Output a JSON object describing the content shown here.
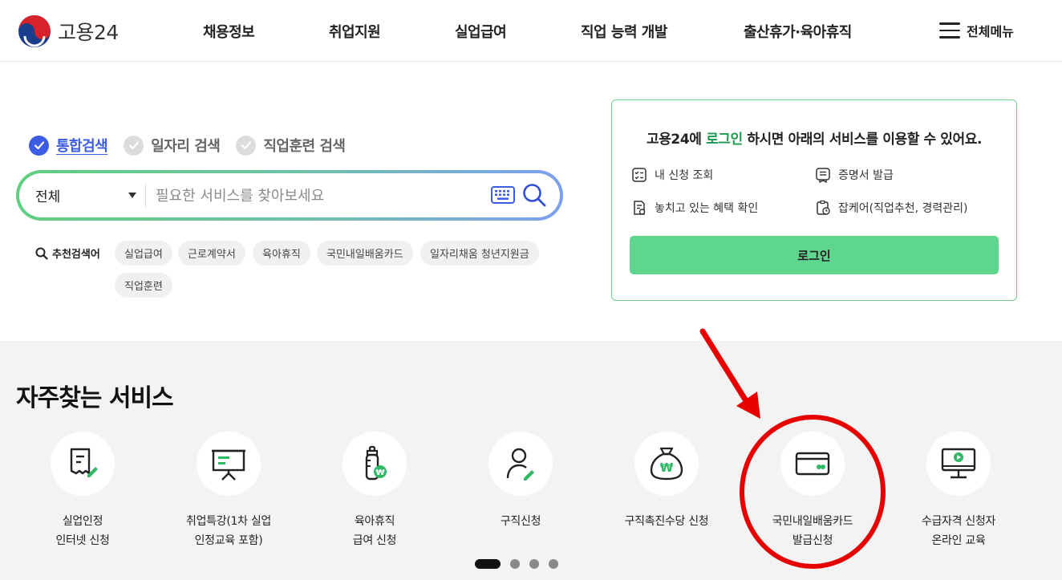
{
  "header": {
    "logo_text": "고용24",
    "nav": [
      "채용정보",
      "취업지원",
      "실업급여",
      "직업 능력 개발",
      "출산휴가·육아휴직"
    ],
    "all_menu_label": "전체메뉴"
  },
  "search": {
    "tabs": [
      {
        "label": "통합검색",
        "active": true
      },
      {
        "label": "일자리 검색",
        "active": false
      },
      {
        "label": "직업훈련 검색",
        "active": false
      }
    ],
    "category_value": "전체",
    "placeholder": "필요한 서비스를 찾아보세요",
    "recommend_label": "추천검색어",
    "keywords": [
      "실업급여",
      "근로계약서",
      "육아휴직",
      "국민내일배움카드",
      "일자리채움 청년지원금",
      "직업훈련"
    ]
  },
  "login_card": {
    "msg_prefix": "고용24에 ",
    "msg_highlight": "로그인",
    "msg_suffix": " 하시면 아래의 서비스를 이용할 수 있어요.",
    "services": [
      "내 신청 조회",
      "증명서 발급",
      "놓치고 있는 혜택 확인",
      "잡케어(직업추천, 경력관리)"
    ],
    "button_label": "로그인"
  },
  "frequent": {
    "title": "자주찾는 서비스",
    "items": [
      {
        "line1": "실업인정",
        "line2": "인터넷 신청",
        "icon": "document-pen-icon"
      },
      {
        "line1": "취업특강(1차 실업",
        "line2": "인정교육 포함)",
        "icon": "presentation-board-icon"
      },
      {
        "line1": "육아휴직",
        "line2": "급여 신청",
        "icon": "baby-bottle-icon"
      },
      {
        "line1": "구직신청",
        "line2": "",
        "icon": "person-pen-icon"
      },
      {
        "line1": "구직촉진수당 신청",
        "line2": "",
        "icon": "money-bag-icon"
      },
      {
        "line1": "국민내일배움카드",
        "line2": "발급신청",
        "icon": "card-icon"
      },
      {
        "line1": "수급자격 신청자",
        "line2": "온라인 교육",
        "icon": "monitor-play-icon"
      }
    ],
    "pages": 4,
    "active_page": 0
  },
  "colors": {
    "accent_blue": "#3d5ce6",
    "accent_green": "#5fd68e",
    "annotation_red": "#e60000"
  }
}
